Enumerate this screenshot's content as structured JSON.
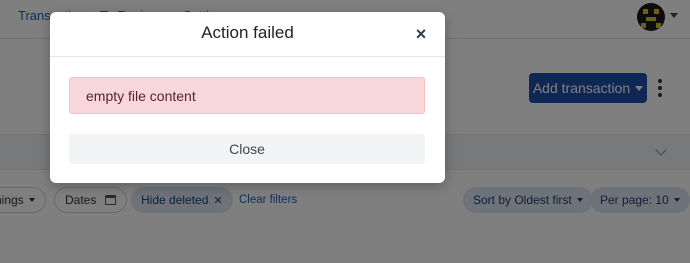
{
  "nav": {
    "items": [
      {
        "label": "Transactions"
      },
      {
        "label": "To Review"
      },
      {
        "label": "Settings"
      }
    ]
  },
  "header": {
    "add_button_label": "Add transaction"
  },
  "filters": {
    "earnings_label": "rnings",
    "dates_label": "Dates",
    "hide_deleted_label": "Hide deleted",
    "clear_filters_label": "Clear filters",
    "sort_label": "Sort by Oldest first",
    "per_page_label": "Per page: 10"
  },
  "modal": {
    "title": "Action failed",
    "close_icon": "×",
    "error_message": "empty file content",
    "close_button_label": "Close"
  },
  "colors": {
    "accent": "#1f4fa8",
    "alert_bg": "#f8d7da",
    "link": "#1f5fbf"
  }
}
